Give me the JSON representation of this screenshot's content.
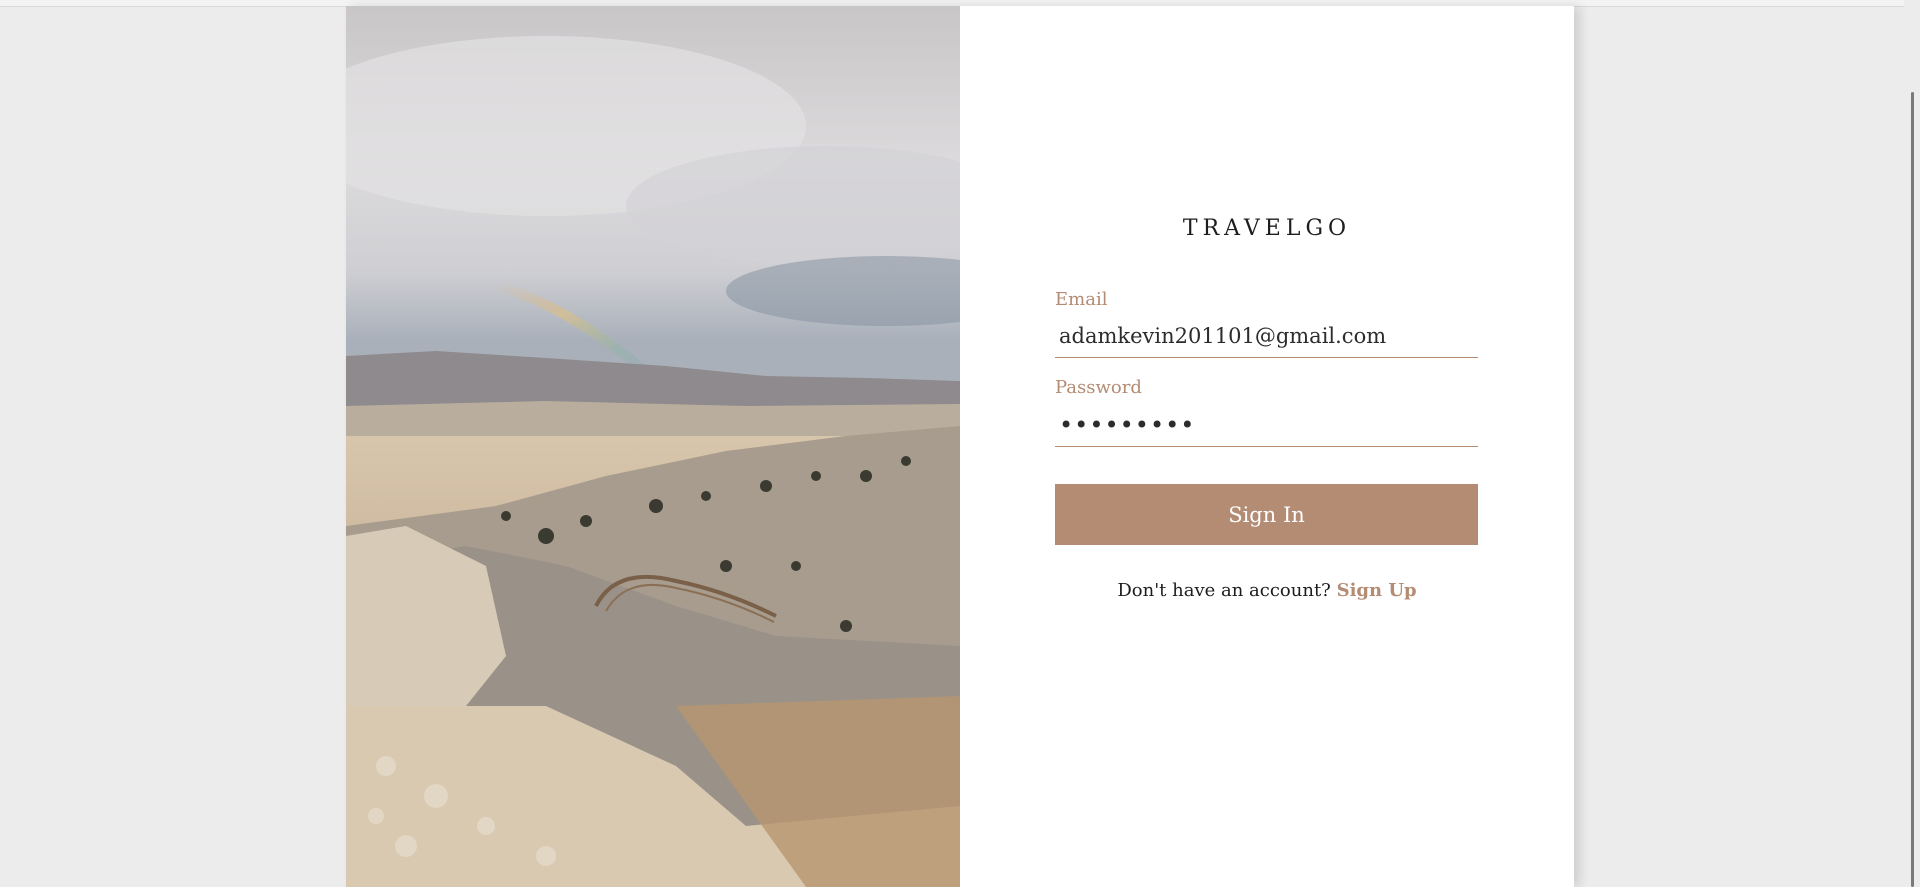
{
  "app": {
    "brand": "TRAVELGO"
  },
  "login": {
    "email_label": "Email",
    "email_value": "adamkevin201101@gmail.com",
    "password_label": "Password",
    "password_value": "•••••••••",
    "signin_label": "Sign In"
  },
  "footer": {
    "prompt": "Don't have an account?",
    "signup_label": "Sign Up"
  },
  "colors": {
    "accent": "#b48b73",
    "background": "#ececec",
    "card": "#ffffff"
  }
}
